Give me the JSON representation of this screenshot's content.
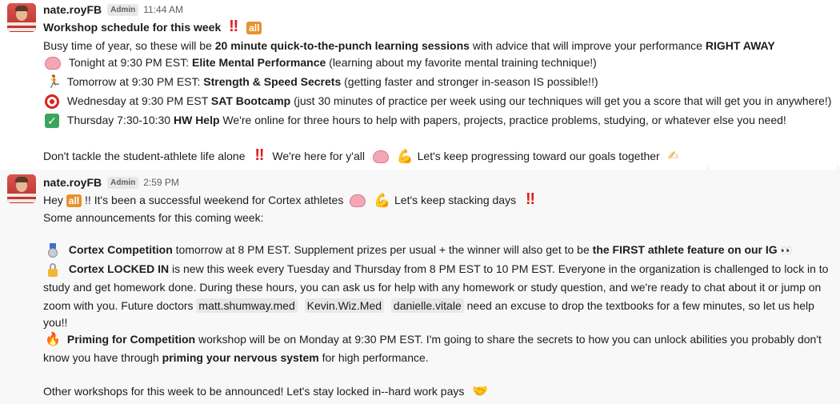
{
  "messages": [
    {
      "user": "nate.royFB",
      "badge": "Admin",
      "time": "11:44 AM",
      "title": "Workshop schedule for this week",
      "title_bang": "‼",
      "title_mention": "all",
      "intro_pre": "Busy time of year, so these will be ",
      "intro_bold": "20 minute quick-to-the-punch learning sessions",
      "intro_mid": " with advice that will improve your performance ",
      "intro_bold2": "RIGHT AWAY",
      "items": [
        {
          "icon": "brain-icon",
          "pre": "Tonight at 9:30 PM EST: ",
          "bold": "Elite Mental Performance",
          "post": " (learning about my favorite mental training technique!)"
        },
        {
          "icon": "runner-icon",
          "pre": "Tomorrow at 9:30 PM EST: ",
          "bold": "Strength & Speed Secrets",
          "post": " (getting faster and stronger in-season IS possible!!)"
        },
        {
          "icon": "target-icon",
          "pre": "Wednesday at 9:30 PM EST ",
          "bold": "SAT Bootcamp",
          "post": " (just 30 minutes of practice per week using our techniques will get you a score that will get you in anywhere!)"
        },
        {
          "icon": "check-icon",
          "pre": "Thursday 7:30-10:30 ",
          "bold": "HW Help",
          "post": " We're online for three hours to help with papers, projects, practice problems, studying, or whatever else you need!"
        }
      ],
      "closing_1": "Don't tackle the student-athlete life alone",
      "closing_bang": "‼",
      "closing_2": "We're here for y'all",
      "closing_3": "Let's keep progressing toward our goals together"
    },
    {
      "user": "nate.royFB",
      "badge": "Admin",
      "time": "2:59 PM",
      "hey": "Hey",
      "hey_mention": "all",
      "hey_post": "!! It's been a successful weekend for Cortex athletes",
      "hey_end": "Let's keep stacking days",
      "hey_bang": "‼",
      "announce": "Some announcements for this coming week:",
      "comp_bold": "Cortex Competition",
      "comp_text": " tomorrow at 8 PM EST. Supplement prizes per usual + the winner will also get to be ",
      "comp_bold2": "the FIRST athlete feature on our IG",
      "locked_bold": "Cortex LOCKED IN",
      "locked_text": " is new this week every Tuesday and Thursday from 8 PM EST to 10 PM EST. Everyone in the organization is challenged to lock in to",
      "locked_line2": "study and get homework done. During these hours, you can ask us for help with any homework or study question, and we're ready to chat about it or jump on",
      "locked_line3_pre": "zoom with you. Future doctors ",
      "mentions": [
        "matt.shumway.med",
        "Kevin.Wiz.Med",
        "danielle.vitale"
      ],
      "locked_line3_post": " need an excuse to drop the textbooks for a few minutes, so let us help",
      "locked_line4": "you!!",
      "prime_bold": "Priming for Competition",
      "prime_text": " workshop will be on Monday at 9:30 PM EST. I'm going to share the secrets to how you can unlock abilities you probably don't",
      "prime_line2_pre": "know you have through ",
      "prime_line2_bold": "priming your nervous system",
      "prime_line2_post": " for high performance.",
      "other": "Other workshops for this week to be announced! Let's stay locked in--hard work pays"
    }
  ],
  "colors": {
    "accent_badge": "#e8912d",
    "bang": "#e01e1e",
    "highlight_bg": "#f8f8f8"
  }
}
